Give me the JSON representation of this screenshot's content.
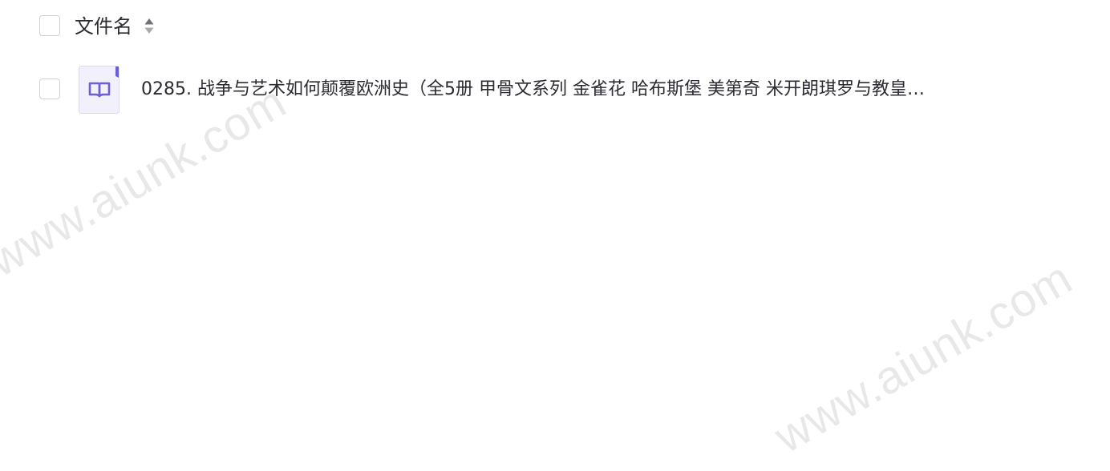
{
  "table": {
    "header": {
      "column_label": "文件名",
      "sort_icon": "sort-updown-icon"
    },
    "rows": [
      {
        "file_icon": "book-icon",
        "name": "0285. 战争与艺术如何颠覆欧洲史（全5册 甲骨文系列 金雀花 哈布斯堡 美第奇 米开朗琪罗与教皇…"
      }
    ]
  },
  "watermark": "www.aiunk.com",
  "colors": {
    "icon_accent": "#6b5fd6",
    "icon_background": "#f2f1fb",
    "checkbox_border": "#cfd2d8",
    "text": "#2b2c33"
  }
}
